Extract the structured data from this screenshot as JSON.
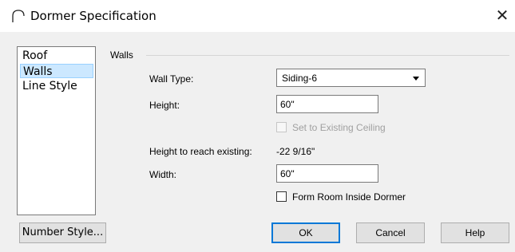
{
  "window": {
    "title": "Dormer Specification",
    "close_glyph": "✕",
    "icon": "dormer-arch-icon"
  },
  "nav": {
    "items": [
      {
        "label": "Roof",
        "selected": false
      },
      {
        "label": "Walls",
        "selected": true
      },
      {
        "label": "Line Style",
        "selected": false
      }
    ]
  },
  "walls": {
    "group_label": "Walls",
    "wall_type_label": "Wall Type:",
    "wall_type_value": "Siding-6",
    "height_label": "Height:",
    "height_value": "60\"",
    "set_existing_label": "Set to Existing Ceiling",
    "set_existing_checked": false,
    "reach_label": "Height to reach existing:",
    "reach_value": "-22 9/16\"",
    "width_label": "Width:",
    "width_value": "60\"",
    "form_room_label": "Form Room Inside Dormer",
    "form_room_checked": false
  },
  "buttons": {
    "number_style": "Number Style...",
    "ok": "OK",
    "cancel": "Cancel",
    "help": "Help"
  },
  "colors": {
    "selection_bg": "#cce8ff",
    "default_button_border": "#0078d7",
    "dialog_bg": "#f0f0f0"
  }
}
